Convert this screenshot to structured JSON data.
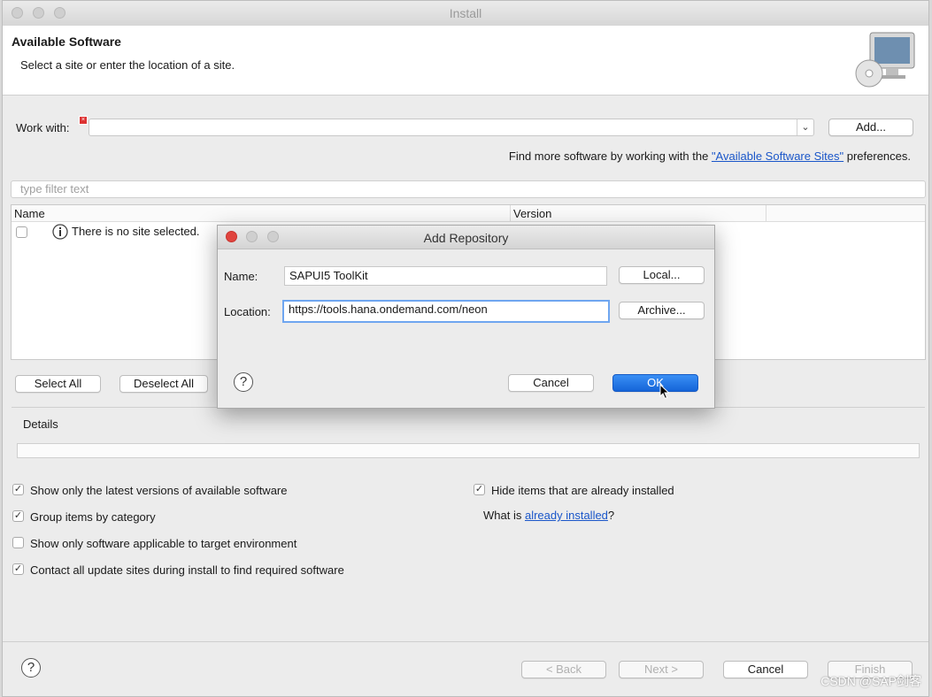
{
  "window": {
    "title": "Install"
  },
  "banner": {
    "title": "Available Software",
    "subtitle": "Select a site or enter the location of a site."
  },
  "work_with": {
    "label": "Work with:",
    "value": "",
    "add_button": "Add..."
  },
  "find_more": {
    "prefix": "Find more software by working with the ",
    "link": "\"Available Software Sites\"",
    "suffix": " preferences."
  },
  "filter": {
    "placeholder": "type filter text"
  },
  "table": {
    "columns": [
      "Name",
      "Version"
    ],
    "rows": [
      {
        "checked": false,
        "text": "There is no site selected."
      }
    ]
  },
  "selection_buttons": {
    "select_all": "Select All",
    "deselect_all": "Deselect All"
  },
  "details": {
    "label": "Details"
  },
  "options": {
    "left": [
      {
        "label": "Show only the latest versions of available software",
        "checked": true
      },
      {
        "label": "Group items by category",
        "checked": true
      },
      {
        "label": "Show only software applicable to target environment",
        "checked": false
      },
      {
        "label": "Contact all update sites during install to find required software",
        "checked": true
      }
    ],
    "right": [
      {
        "label": "Hide items that are already installed",
        "checked": true
      }
    ],
    "what_is": {
      "prefix": "What is ",
      "link": "already installed",
      "suffix": "?"
    }
  },
  "footer": {
    "back": "< Back",
    "next": "Next >",
    "cancel": "Cancel",
    "finish": "Finish"
  },
  "dialog": {
    "title": "Add Repository",
    "name_label": "Name:",
    "name_value": "SAPUI5 ToolKit",
    "location_label": "Location:",
    "location_value": "https://tools.hana.ondemand.com/neon",
    "local_button": "Local...",
    "archive_button": "Archive...",
    "cancel_button": "Cancel",
    "ok_button": "OK"
  },
  "watermark": "CSDN @SAP剑客",
  "colors": {
    "accent": "#1565d8",
    "link": "#1a56c9",
    "close_red": "#e0443e"
  }
}
